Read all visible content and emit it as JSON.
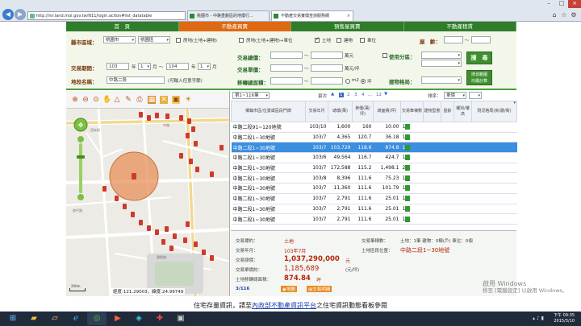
{
  "browser": {
    "url": "http://lvr.land.moi.gov.tw/N11/login.action#list_datatable",
    "tabs": [
      {
        "title": "桃園市 - 中路重劃區的地價行..."
      },
      {
        "title": "不動產交易實價查詢服務網"
      }
    ]
  },
  "nav": {
    "tabs": [
      "首　頁",
      "不動產買賣",
      "預售屋買賣",
      "不動產租賃"
    ]
  },
  "form": {
    "region_label": "縣市區域：",
    "city": "桃園市",
    "district": "桃園區",
    "type_options": [
      "房地(土地+建物)",
      "房地(土地+建物)+車位",
      "土地",
      "建物",
      "車位"
    ],
    "age_label": "屋　齡：",
    "price_label": "交易總價：",
    "unit_wan": "萬元",
    "usage_label": "使用分區：",
    "unit_price_label": "交易單價：",
    "unit_wan_ping": "萬元/坪",
    "period_label": "交易期間：",
    "start_year": "103",
    "start_month": "1",
    "end_year": "104",
    "end_month": "1",
    "year_char": "年",
    "month_char": "月",
    "to": "～",
    "search_button": "搜　尋",
    "address_label": "地段名稱：",
    "address_value": "中路二段",
    "address_hint": "(可輸入任意字節)",
    "area_label": "移轉總面積：",
    "unit_m2": "m2",
    "unit_ping": "坪",
    "layout_label": "建物格局：",
    "avg_button_line1": "搜尋範圍",
    "avg_button_line2": "均價計算"
  },
  "results": {
    "page_select": "第1~116筆",
    "page_label": "頁次",
    "pages": [
      "1",
      "2",
      "3",
      "4",
      "...",
      "12"
    ],
    "sort_label": "排序：",
    "sort_value": "單價",
    "columns": [
      "鄉鎮市區/位置或區段門牌",
      "交易年月",
      "總價(萬)",
      "單價(萬/坪)",
      "總面積(坪)",
      "交易筆棟數",
      "建物型態",
      "屋齡",
      "樓別/樓高",
      "現況格局(房/廳/衛)"
    ],
    "rows": [
      {
        "addr": "中路二段91~120地號",
        "date": "103/10",
        "total": "1,600",
        "unit": "160",
        "area": "10.00",
        "count": "1"
      },
      {
        "addr": "中路二段1~30地號",
        "date": "103/7",
        "total": "4,365",
        "unit": "120.7",
        "area": "36.18",
        "count": "1"
      },
      {
        "addr": "中路二段1~30地號",
        "date": "103/7",
        "total": "103,729",
        "unit": "118.6",
        "area": "874.8",
        "count": "1"
      },
      {
        "addr": "中路二段1~30地號",
        "date": "103/6",
        "total": "49,564",
        "unit": "116.7",
        "area": "424.7",
        "count": "1"
      },
      {
        "addr": "中路二段1~30地號",
        "date": "103/7",
        "total": "172,588",
        "unit": "115.2",
        "area": "1,498.1",
        "count": "2"
      },
      {
        "addr": "中路二段1~30地號",
        "date": "103/8",
        "total": "8,396",
        "unit": "111.6",
        "area": "75.23",
        "count": "1"
      },
      {
        "addr": "中路二段1~30地號",
        "date": "103/7",
        "total": "11,360",
        "unit": "111.6",
        "area": "101.79",
        "count": "1"
      },
      {
        "addr": "中路二段1~30地號",
        "date": "103/7",
        "total": "2,791",
        "unit": "111.6",
        "area": "25.01",
        "count": "1"
      },
      {
        "addr": "中路二段1~30地號",
        "date": "103/7",
        "total": "2,791",
        "unit": "111.6",
        "area": "25.01",
        "count": "1"
      },
      {
        "addr": "中路二段1~30地號",
        "date": "103/7",
        "total": "2,791",
        "unit": "111.6",
        "area": "25.01",
        "count": "1"
      }
    ]
  },
  "detail": {
    "target_label": "交易標的：",
    "target_value": "土地",
    "date_label": "交易年月：",
    "date_value": "103年7月",
    "total_label": "交易總價：",
    "total_value": "1,037,290,000",
    "total_unit": "元",
    "unit_label": "交易單價約：",
    "unit_value": "1,185,689",
    "unit_unit": "(元/坪)",
    "area_label": "土地移轉總面積：",
    "area_value": "874.84",
    "area_unit": "坪",
    "count_label": "交易筆棟數：",
    "count_value": "土地：1筆 建物：0棟(戶) 車位：0個",
    "addr_label": "土地區段位置：",
    "addr_value": "中路二段1~30地號",
    "page_indicator": "3/116",
    "map_button": "地圖",
    "detail_button": "交易明細"
  },
  "map": {
    "coord_label": "經度:",
    "lng": "121.29003",
    "lat_label": "，緯度:",
    "lat": "24.99749",
    "scale": "200m",
    "places": [
      "西安街",
      "中路",
      "南平路",
      "國際路"
    ]
  },
  "marquee": {
    "prefix": "住宅存量資訊，請至",
    "link": "內政部不動產資訊平台",
    "suffix": "之住宅資訊動態看板參閱"
  },
  "watermark": {
    "line1": "啟用 Windows",
    "line2": "移至 [電腦設定] 以啟用 Windows。"
  },
  "taskbar": {
    "time": "下午 09:35",
    "date": "2015/3/10"
  }
}
